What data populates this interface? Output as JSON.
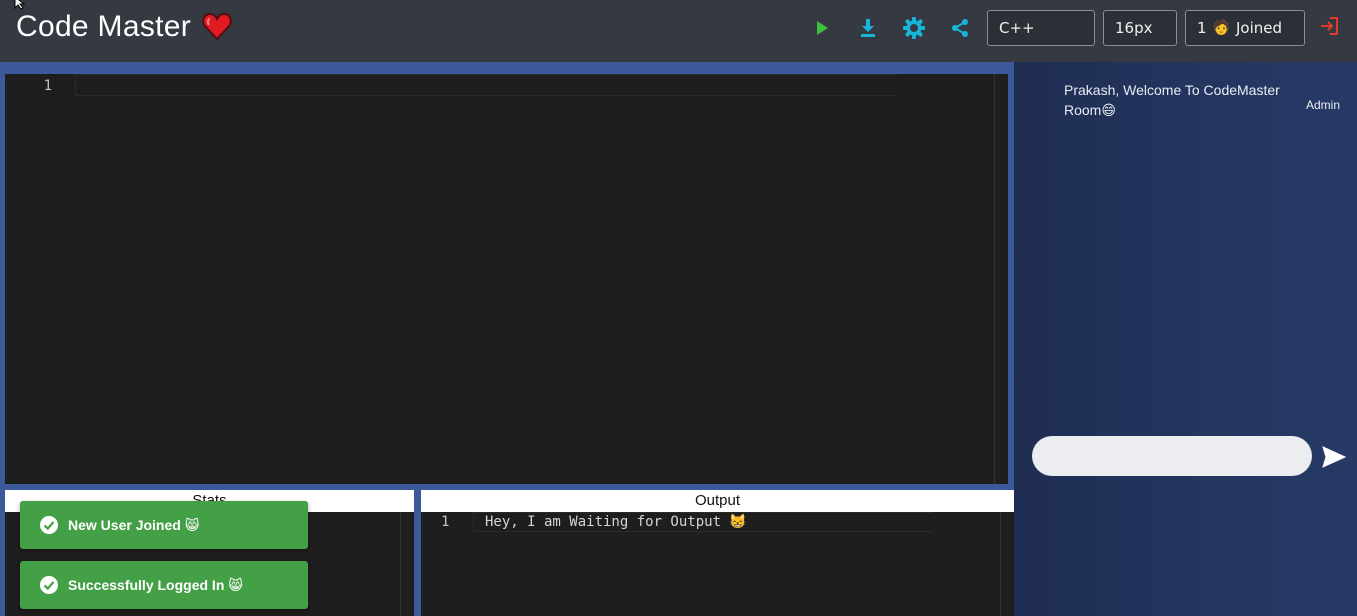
{
  "header": {
    "title": "Code Master",
    "icons": [
      "heart-icon",
      "play-icon",
      "download-icon",
      "settings-icon",
      "share-icon",
      "logout-icon"
    ],
    "language": "C++",
    "font_size": "16px",
    "joined_count": "1",
    "joined_face": "🧑",
    "joined_label": "Joined"
  },
  "editor": {
    "line_numbers": [
      "1"
    ],
    "code": ""
  },
  "panels": {
    "stats_title": "Stats",
    "output_title": "Output",
    "output_line_number": "1",
    "output_text": "Hey, I am Waiting for Output 😸"
  },
  "chat": {
    "message": "Prakash, Welcome To CodeMaster Room😄",
    "sender": "Admin",
    "input_value": "",
    "input_placeholder": ""
  },
  "toasts": [
    {
      "text": "New User Joined 😸"
    },
    {
      "text": "Successfully Logged In 😸"
    }
  ],
  "colors": {
    "header_bg": "#353a42",
    "frame_blue": "#3c5a9a",
    "editor_bg": "#1e1e1e",
    "toast_green": "#44a047",
    "play_green": "#3ec13e",
    "icon_cyan": "#17b6d8",
    "logout_red": "#e23a2b",
    "chat_bg": "#243660"
  }
}
